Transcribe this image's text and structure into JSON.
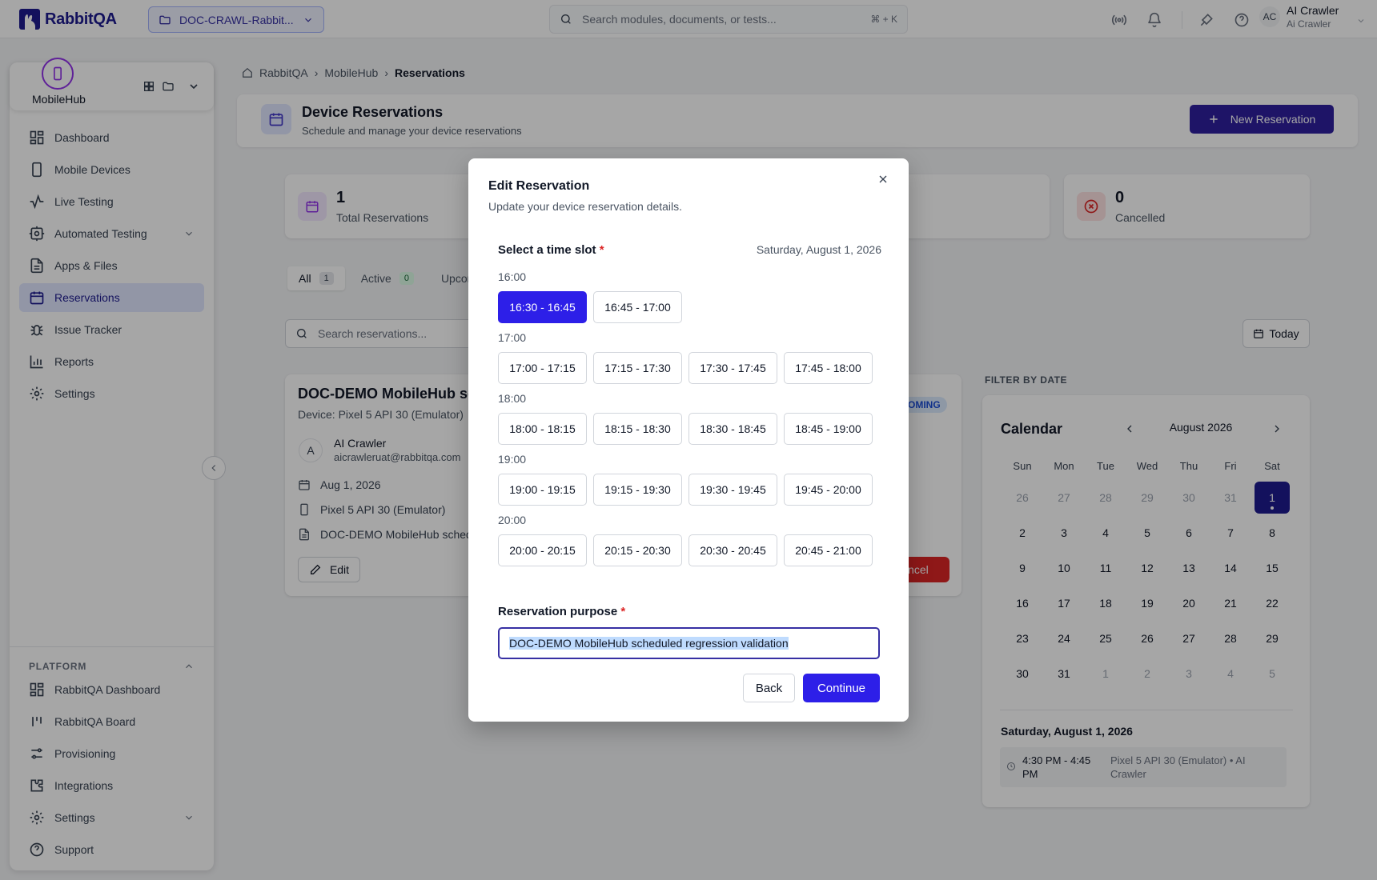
{
  "app": {
    "logo_text": "RabbitQA",
    "brand_color": "#1e1b8f"
  },
  "topbar": {
    "project_select": "DOC-CRAWL-Rabbit...",
    "search_placeholder": "Search modules, documents, or tests...",
    "search_shortcut": "⌘ + K",
    "user": {
      "initials": "AC",
      "name": "AI Crawler",
      "subtitle": "Ai Crawler"
    }
  },
  "sidebar": {
    "workspace_name": "MobileHub",
    "items": [
      {
        "label": "Dashboard",
        "icon": "dashboard-icon"
      },
      {
        "label": "Mobile Devices",
        "icon": "smartphone-icon"
      },
      {
        "label": "Live Testing",
        "icon": "activity-icon"
      },
      {
        "label": "Automated Testing",
        "icon": "bot-icon"
      },
      {
        "label": "Apps & Files",
        "icon": "file-icon"
      },
      {
        "label": "Reservations",
        "icon": "calendar-icon"
      },
      {
        "label": "Issue Tracker",
        "icon": "bug-icon"
      },
      {
        "label": "Reports",
        "icon": "bar-chart-icon"
      },
      {
        "label": "Settings",
        "icon": "gear-icon"
      }
    ],
    "platform_header": "PLATFORM",
    "platform_items": [
      {
        "label": "RabbitQA Dashboard",
        "icon": "dashboard-icon"
      },
      {
        "label": "RabbitQA Board",
        "icon": "kanban-icon"
      },
      {
        "label": "Provisioning",
        "icon": "sliders-icon"
      },
      {
        "label": "Integrations",
        "icon": "puzzle-icon"
      },
      {
        "label": "Settings",
        "icon": "gear-icon"
      },
      {
        "label": "Support",
        "icon": "help-circle-icon"
      }
    ]
  },
  "breadcrumb": [
    "RabbitQA",
    "MobileHub",
    "Reservations"
  ],
  "page": {
    "title": "Device Reservations",
    "subtitle": "Schedule and manage your device reservations",
    "new_button": "New Reservation"
  },
  "stats": [
    {
      "value": "1",
      "label": "Total Reservations"
    },
    {
      "value": "0",
      "label": "Cancelled"
    }
  ],
  "tabs": [
    {
      "label": "All",
      "count": "1"
    },
    {
      "label": "Active",
      "count": "0"
    },
    {
      "label": "Upcom"
    }
  ],
  "search": {
    "placeholder": "Search reservations..."
  },
  "today_button": "Today",
  "reservation_card": {
    "title": "DOC-DEMO MobileHub sc",
    "device": "Device: Pixel 5 API 30 (Emulator)",
    "avatar": "A",
    "user_name": "AI Crawler",
    "user_email": "aicrawleruat@rabbitqa.com",
    "date": "Aug 1, 2026",
    "device_line": "Pixel 5 API 30 (Emulator)",
    "purpose_line": "DOC-DEMO MobileHub schedu",
    "edit_label": "Edit",
    "badge": "OMING",
    "cancel_label": "ancel"
  },
  "calendar": {
    "filter_label": "FILTER BY DATE",
    "title": "Calendar",
    "month": "August 2026",
    "weekdays": [
      "Sun",
      "Mon",
      "Tue",
      "Wed",
      "Thu",
      "Fri",
      "Sat"
    ],
    "days": [
      "26",
      "27",
      "28",
      "29",
      "30",
      "31",
      "1",
      "2",
      "3",
      "4",
      "5",
      "6",
      "7",
      "8",
      "9",
      "10",
      "11",
      "12",
      "13",
      "14",
      "15",
      "16",
      "17",
      "18",
      "19",
      "20",
      "21",
      "22",
      "23",
      "24",
      "25",
      "26",
      "27",
      "28",
      "29",
      "30",
      "31",
      "1",
      "2",
      "3",
      "4",
      "5"
    ],
    "selected_date_label": "Saturday, August 1, 2026",
    "event": {
      "time": "4:30 PM - 4:45 PM",
      "desc": "Pixel 5 API 30 (Emulator) • AI Crawler"
    }
  },
  "modal": {
    "title": "Edit Reservation",
    "subtitle": "Update your device reservation details.",
    "slot_label": "Select a time slot",
    "required_mark": "*",
    "date": "Saturday, August 1, 2026",
    "groups": [
      {
        "hour": "16:00",
        "slots": [
          "16:30 - 16:45",
          "16:45 - 17:00"
        ]
      },
      {
        "hour": "17:00",
        "slots": [
          "17:00 - 17:15",
          "17:15 - 17:30",
          "17:30 - 17:45",
          "17:45 - 18:00"
        ]
      },
      {
        "hour": "18:00",
        "slots": [
          "18:00 - 18:15",
          "18:15 - 18:30",
          "18:30 - 18:45",
          "18:45 - 19:00"
        ]
      },
      {
        "hour": "19:00",
        "slots": [
          "19:00 - 19:15",
          "19:15 - 19:30",
          "19:30 - 19:45",
          "19:45 - 20:00"
        ]
      },
      {
        "hour": "20:00",
        "slots": [
          "20:00 - 20:15",
          "20:15 - 20:30",
          "20:30 - 20:45",
          "20:45 - 21:00"
        ]
      }
    ],
    "selected_slot": "16:30 - 16:45",
    "purpose_label": "Reservation purpose",
    "purpose_value": "DOC-DEMO MobileHub scheduled regression validation",
    "back_label": "Back",
    "continue_label": "Continue"
  }
}
